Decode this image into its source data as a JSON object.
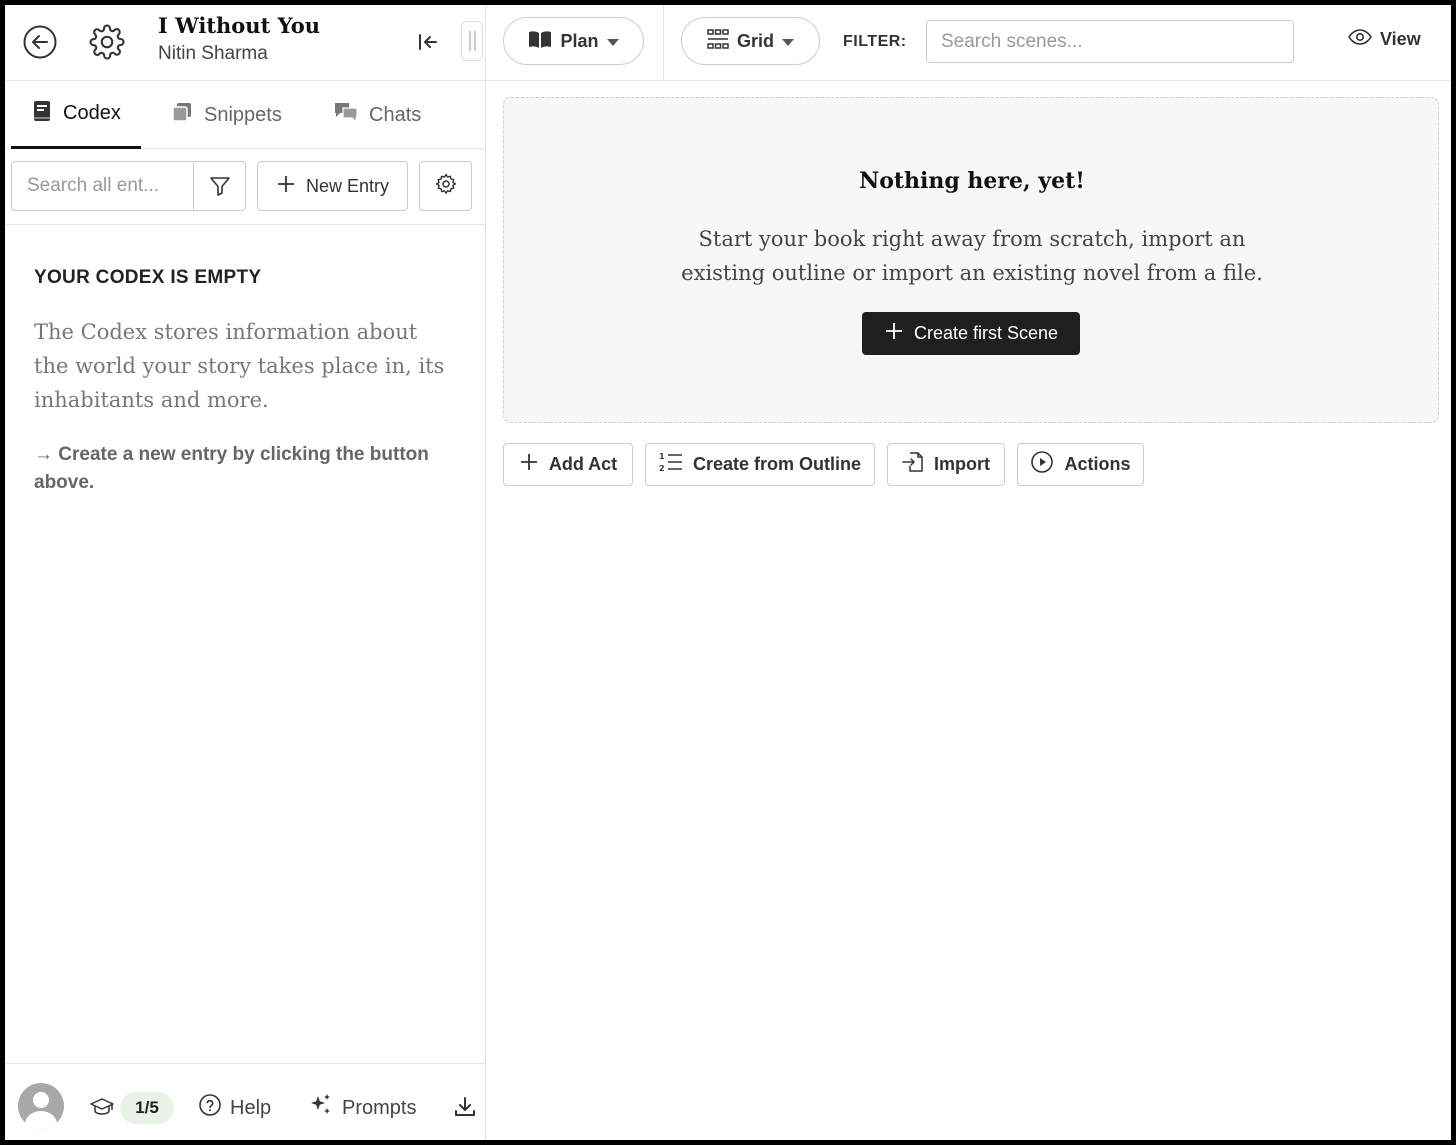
{
  "sidebar": {
    "header": {
      "back_icon": "arrow-left-circle-icon",
      "settings_icon": "gear-icon",
      "book_title": "I Without You",
      "author": "Nitin Sharma",
      "collapse_icon": "collapse-left-icon"
    },
    "tabs": [
      {
        "label": "Codex",
        "icon": "book-icon",
        "active": true
      },
      {
        "label": "Snippets",
        "icon": "snippets-icon",
        "active": false
      },
      {
        "label": "Chats",
        "icon": "chat-bubbles-icon",
        "active": false
      }
    ],
    "toolbar": {
      "search_placeholder": "Search all ent...",
      "new_entry_label": "New Entry"
    },
    "empty": {
      "title": "YOUR CODEX IS EMPTY",
      "description": "The Codex stores information about the world your story takes place in, its inhabitants and more.",
      "hint": "→ Create a new entry by clicking the button above."
    },
    "footer": {
      "progress": "1/5",
      "help_label": "Help",
      "prompts_label": "Prompts"
    }
  },
  "main": {
    "header": {
      "plan_label": "Plan",
      "grid_label": "Grid",
      "filter_label": "FILTER:",
      "search_placeholder": "Search scenes...",
      "view_label": "View"
    },
    "empty": {
      "title": "Nothing here, yet!",
      "description": "Start your book right away from scratch, import an existing outline or import an existing novel from a file.",
      "create_label": "Create first Scene"
    },
    "actions": {
      "add_act_label": "Add Act",
      "outline_label": "Create from Outline",
      "import_label": "Import",
      "actions_label": "Actions"
    }
  },
  "colors": {
    "accent_dark": "#1f1f1f",
    "badge_bg": "#e7f3e4",
    "border": "#cccccc"
  }
}
